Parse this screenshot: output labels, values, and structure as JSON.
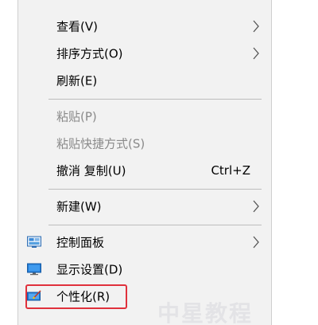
{
  "menu": {
    "items": [
      {
        "label": "查看(V)",
        "submenu": true
      },
      {
        "label": "排序方式(O)",
        "submenu": true
      },
      {
        "label": "刷新(E)"
      },
      {
        "label": "粘贴(P)",
        "disabled": true
      },
      {
        "label": "粘贴快捷方式(S)",
        "disabled": true
      },
      {
        "label": "撤消 复制(U)",
        "shortcut": "Ctrl+Z"
      },
      {
        "label": "新建(W)",
        "submenu": true
      },
      {
        "label": "控制面板",
        "icon": "control-panel-icon",
        "submenu": true
      },
      {
        "label": "显示设置(D)",
        "icon": "display-settings-icon"
      },
      {
        "label": "个性化(R)",
        "icon": "personalize-icon",
        "highlighted": true
      }
    ]
  },
  "watermark": "中星教程",
  "colors": {
    "menu_bg": "#f2f2f2",
    "highlight_border": "#e0313c",
    "disabled_text": "#8a8a8a"
  }
}
